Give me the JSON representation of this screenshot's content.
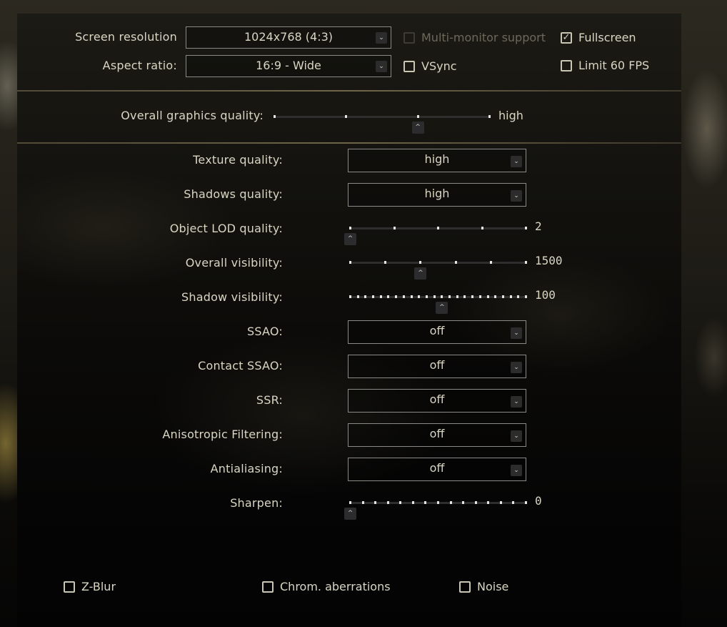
{
  "display": {
    "screen_resolution": {
      "label": "Screen resolution",
      "value": "1024x768 (4:3)"
    },
    "aspect_ratio": {
      "label": "Aspect ratio:",
      "value": "16:9 - Wide"
    },
    "multi_monitor": {
      "label": "Multi-monitor support",
      "checked": false,
      "disabled": true
    },
    "fullscreen": {
      "label": "Fullscreen",
      "checked": true
    },
    "vsync": {
      "label": "VSync",
      "checked": false
    },
    "limit_fps": {
      "label": "Limit 60 FPS",
      "checked": false
    }
  },
  "overall_quality": {
    "label": "Overall graphics quality:",
    "value": "high",
    "ticks": 4,
    "position": 2
  },
  "settings": {
    "texture_quality": {
      "label": "Texture quality:",
      "value": "high"
    },
    "shadows_quality": {
      "label": "Shadows quality:",
      "value": "high"
    },
    "object_lod": {
      "label": "Object LOD quality:",
      "value": "2",
      "ticks": 5,
      "position": 0
    },
    "overall_visibility": {
      "label": "Overall visibility:",
      "value": "1500",
      "ticks": 6,
      "position": 2
    },
    "shadow_visibility": {
      "label": "Shadow visibility:",
      "value": "100",
      "ticks": 24,
      "position": 12
    },
    "ssao": {
      "label": "SSAO:",
      "value": "off"
    },
    "contact_ssao": {
      "label": "Contact SSAO:",
      "value": "off"
    },
    "ssr": {
      "label": "SSR:",
      "value": "off"
    },
    "anisotropic": {
      "label": "Anisotropic Filtering:",
      "value": "off"
    },
    "antialiasing": {
      "label": "Antialiasing:",
      "value": "off"
    },
    "sharpen": {
      "label": "Sharpen:",
      "value": "0",
      "ticks": 15,
      "position": 0
    }
  },
  "postfx": {
    "zblur": {
      "label": "Z-Blur",
      "checked": false
    },
    "chrom": {
      "label": "Chrom. aberrations",
      "checked": false
    },
    "noise": {
      "label": "Noise",
      "checked": false
    }
  },
  "icons": {
    "chevron_down": "⌄",
    "chevron_up": "^",
    "check": "✓"
  }
}
